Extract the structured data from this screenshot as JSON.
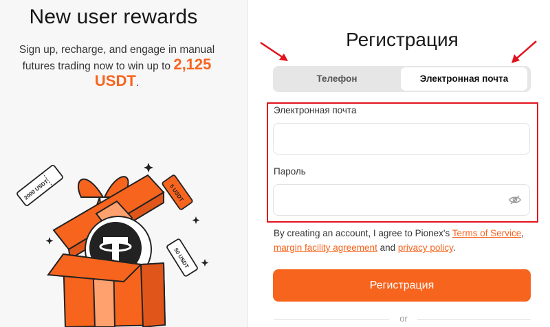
{
  "promo": {
    "title": "New user rewards",
    "desc_prefix": "Sign up, recharge, and engage in manual futures trading now to win up to ",
    "amount": "2,125 USDT",
    "desc_suffix": ".",
    "tickets": [
      "2000 USDT",
      "5 USDT",
      "50 USDT"
    ]
  },
  "registration": {
    "title": "Регистрация",
    "tabs": [
      {
        "label": "Телефон",
        "selected": false
      },
      {
        "label": "Электронная почта",
        "selected": true
      }
    ],
    "email_label": "Электронная почта",
    "email_value": "",
    "password_label": "Пароль",
    "password_value": "",
    "terms_prefix": "By creating an account, I agree to Pionex's ",
    "terms_link": "Terms of Service",
    "terms_sep": ", ",
    "margin_link": "margin facility agreement",
    "terms_and": " and ",
    "privacy_link": "privacy policy",
    "terms_end": ".",
    "submit_label": "Регистрация",
    "or_label": "or"
  },
  "colors": {
    "accent": "#f7641e",
    "highlight": "#e3121c",
    "tab_bg": "#e6e6e6"
  },
  "icons": {
    "password_toggle": "eye-off-icon",
    "annotation_arrows": "red-arrow-icon"
  }
}
